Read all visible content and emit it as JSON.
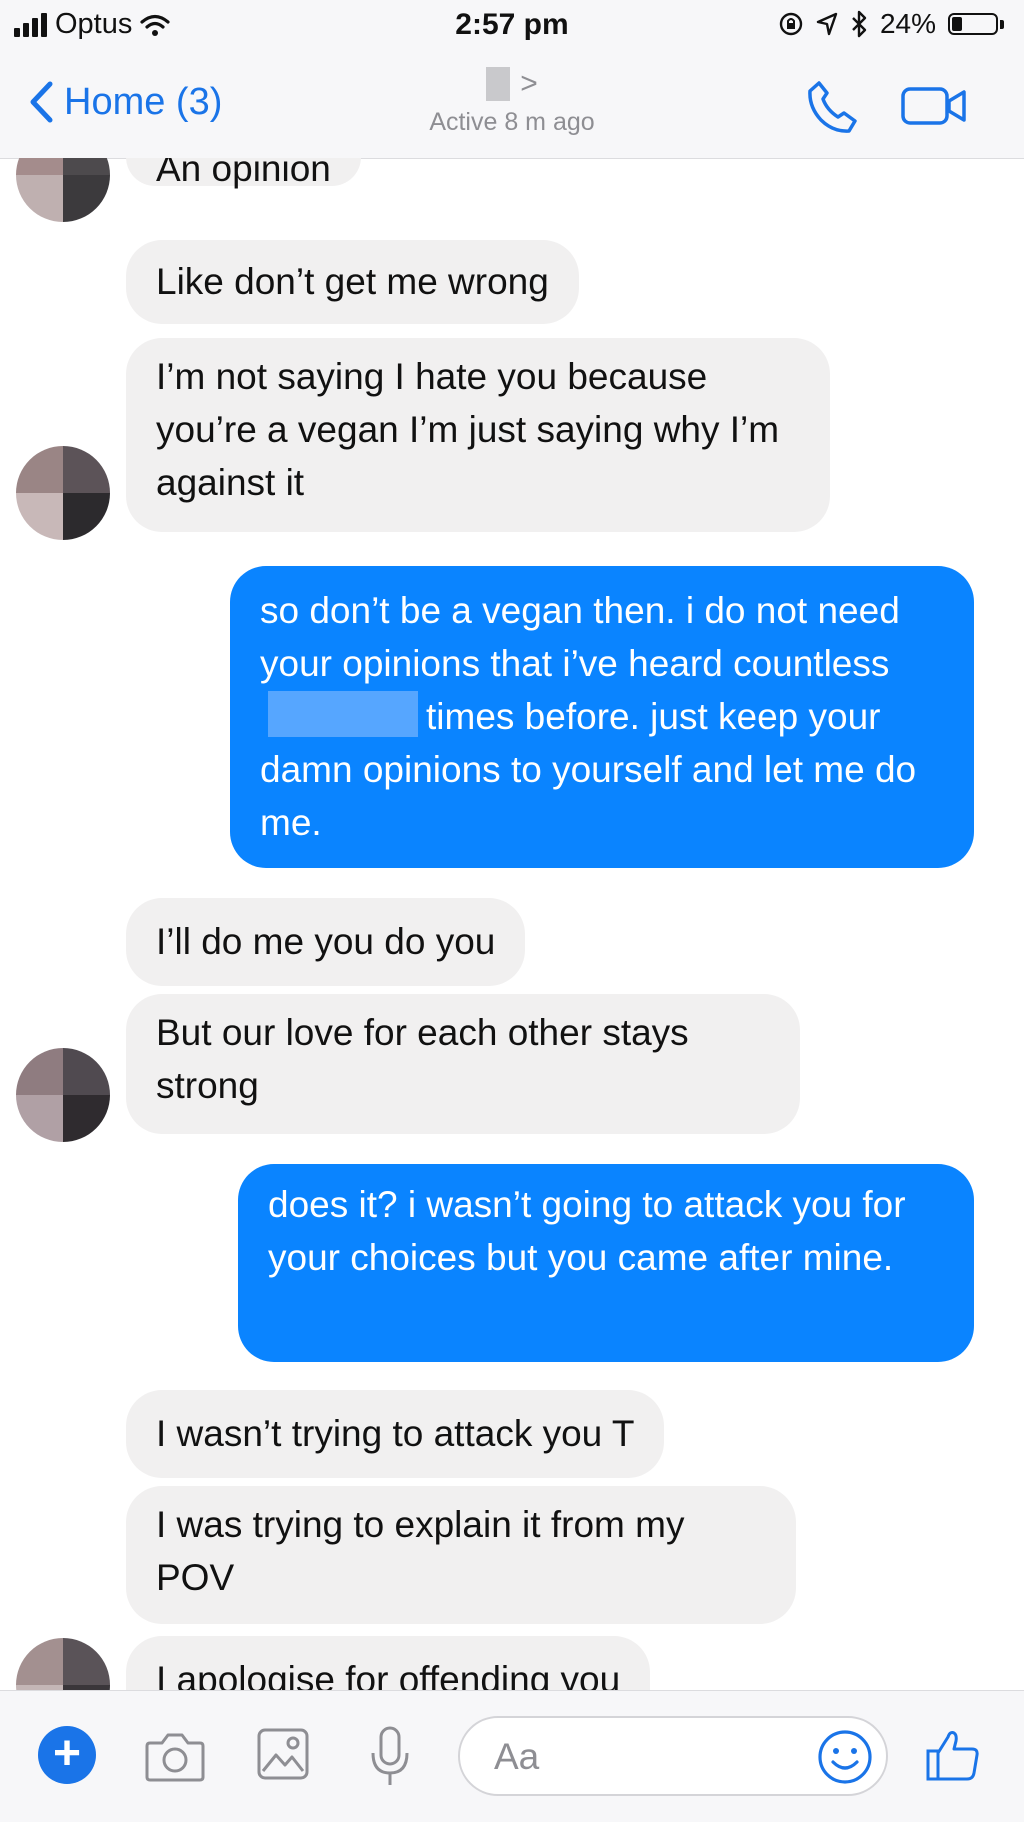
{
  "status_bar": {
    "carrier": "Optus",
    "time": "2:57 pm",
    "battery": "24%",
    "battery_level": 0.24
  },
  "header": {
    "back_label": "Home (3)",
    "status": "Active 8 m ago",
    "chevron": ">"
  },
  "messages": [
    {
      "from": "them",
      "text": "An opinion"
    },
    {
      "from": "them",
      "text": "Like don’t get me wrong"
    },
    {
      "from": "them",
      "text": "I’m not saying I hate you because you’re a vegan I’m just saying why I’m against it"
    },
    {
      "from": "me",
      "text_1": "so don’t be a vegan then. i do not need your opinions that i’ve heard countless",
      "text_2": "times before. just keep your damn opinions to yourself and let me do me."
    },
    {
      "from": "them",
      "text": "I’ll do me you do you"
    },
    {
      "from": "them",
      "text": "But our love for each other stays strong"
    },
    {
      "from": "me",
      "text": "does it? i wasn’t going to attack you for your choices but you came after mine."
    },
    {
      "from": "them",
      "text": "I wasn’t trying to attack you T"
    },
    {
      "from": "them",
      "text": "I was trying to explain it from my POV"
    },
    {
      "from": "them",
      "text": "I apologise for offending you"
    }
  ],
  "composer": {
    "placeholder": "Aa",
    "icons": [
      "plus-icon",
      "camera-icon",
      "image-icon",
      "microphone-icon",
      "emoji-icon",
      "thumbs-up-icon"
    ]
  },
  "colors": {
    "accent": "#1a74e8",
    "outgoing": "#0a84ff",
    "incoming": "#f1f0f0"
  }
}
